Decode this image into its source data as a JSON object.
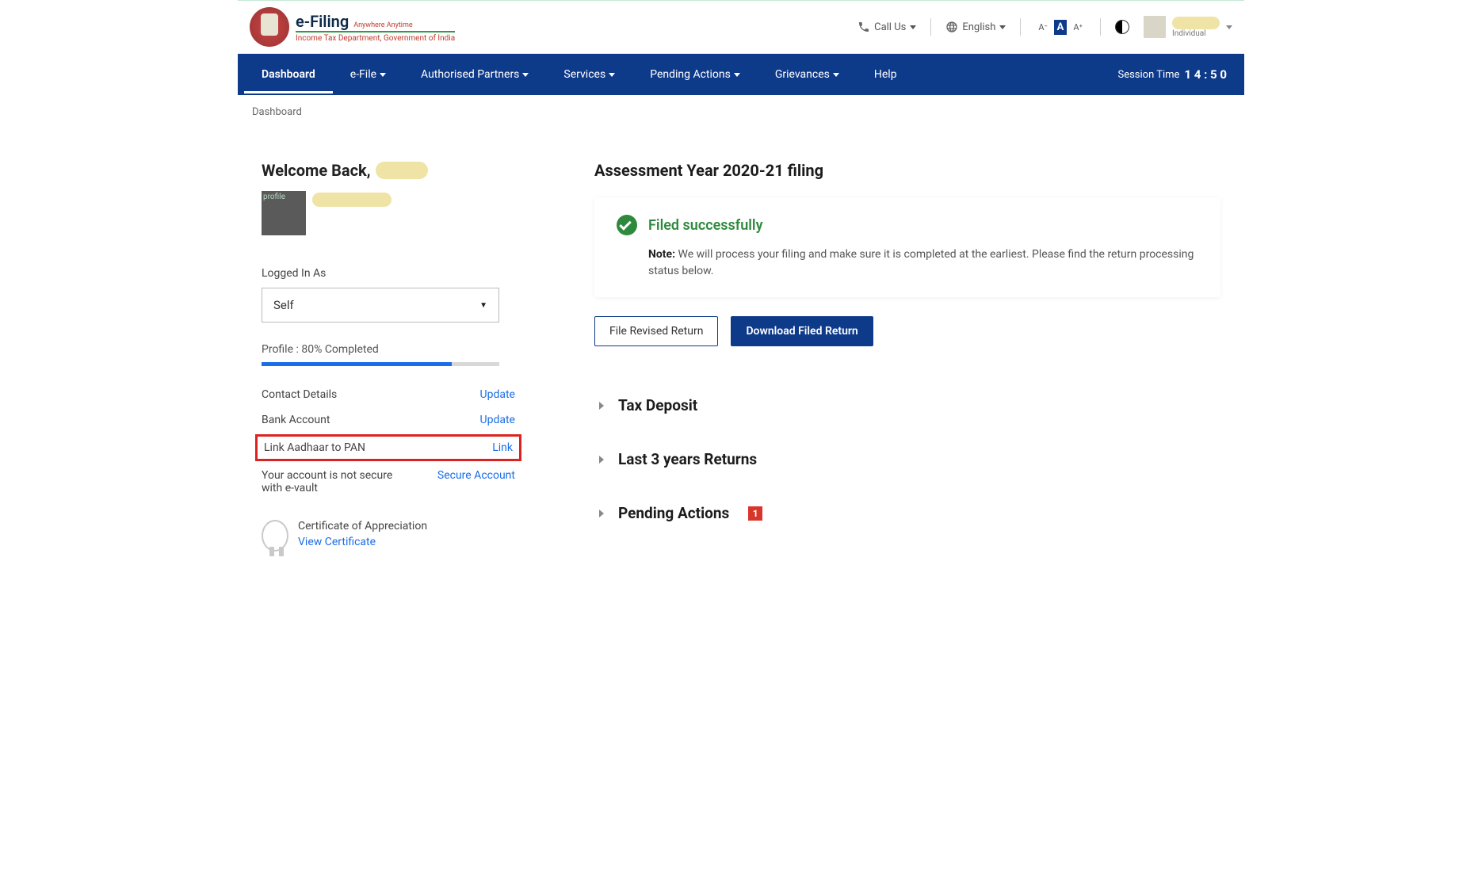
{
  "header": {
    "logo_title": "e-Filing",
    "logo_tagline": "Anywhere Anytime",
    "logo_subtitle": "Income Tax Department, Government of India",
    "call_label": "Call Us",
    "language": "English",
    "user_role": "Individual"
  },
  "nav": {
    "items": [
      {
        "label": "Dashboard",
        "active": true,
        "dropdown": false
      },
      {
        "label": "e-File",
        "active": false,
        "dropdown": true
      },
      {
        "label": "Authorised Partners",
        "active": false,
        "dropdown": true
      },
      {
        "label": "Services",
        "active": false,
        "dropdown": true
      },
      {
        "label": "Pending Actions",
        "active": false,
        "dropdown": true
      },
      {
        "label": "Grievances",
        "active": false,
        "dropdown": true
      },
      {
        "label": "Help",
        "active": false,
        "dropdown": false
      }
    ],
    "session_label": "Session Time",
    "session_digits": "1 4 : 5 0"
  },
  "breadcrumb": "Dashboard",
  "left": {
    "welcome_prefix": "Welcome Back,",
    "profile_alt": "profile",
    "logged_in_label": "Logged In As",
    "logged_in_value": "Self",
    "profile_label": "Profile :",
    "profile_pct": "80% Completed",
    "rows": [
      {
        "label": "Contact Details",
        "link": "Update",
        "hl": false
      },
      {
        "label": "Bank Account",
        "link": "Update",
        "hl": false
      },
      {
        "label": "Link Aadhaar to PAN",
        "link": "Link",
        "hl": true
      },
      {
        "label": "Your account is not secure with e-vault",
        "link": "Secure Account",
        "hl": false
      }
    ],
    "cert_label": "Certificate of Appreciation",
    "cert_link": "View Certificate"
  },
  "right": {
    "title": "Assessment Year 2020-21 filing",
    "status_title": "Filed successfully",
    "note_label": "Note:",
    "note_text": "We will process your filing and make sure it is completed at the earliest. Please find the return processing status below.",
    "btn_outline": "File Revised Return",
    "btn_primary": "Download Filed Return",
    "accordions": [
      {
        "title": "Tax Deposit",
        "badge": ""
      },
      {
        "title": "Last 3 years Returns",
        "badge": ""
      },
      {
        "title": "Pending Actions",
        "badge": "1"
      }
    ]
  }
}
